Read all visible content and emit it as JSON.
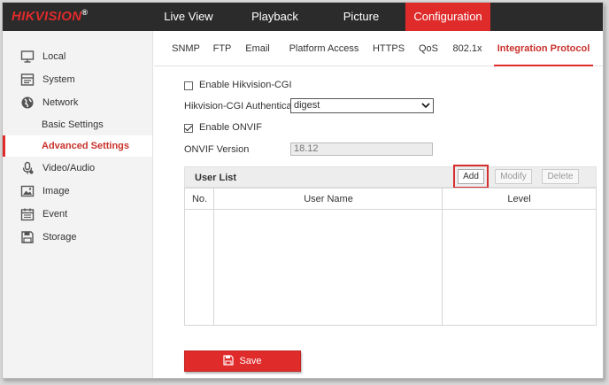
{
  "brand": {
    "logo_text": "HIKVISION",
    "logo_mark": "®"
  },
  "nav": {
    "items": [
      {
        "label": "Live View"
      },
      {
        "label": "Playback"
      },
      {
        "label": "Picture"
      },
      {
        "label": "Configuration"
      }
    ],
    "active": "Configuration"
  },
  "sidebar": {
    "items": [
      {
        "label": "Local",
        "icon": "monitor-icon"
      },
      {
        "label": "System",
        "icon": "system-icon"
      },
      {
        "label": "Network",
        "icon": "globe-icon"
      },
      {
        "label": "Basic Settings"
      },
      {
        "label": "Advanced Settings"
      },
      {
        "label": "Video/Audio",
        "icon": "microphone-icon"
      },
      {
        "label": "Image",
        "icon": "image-icon"
      },
      {
        "label": "Event",
        "icon": "calendar-icon"
      },
      {
        "label": "Storage",
        "icon": "floppy-icon"
      }
    ],
    "active": "Advanced Settings"
  },
  "tabs": {
    "items": [
      {
        "label": "SNMP"
      },
      {
        "label": "FTP"
      },
      {
        "label": "Email"
      },
      {
        "label": "Platform Access"
      },
      {
        "label": "HTTPS"
      },
      {
        "label": "QoS"
      },
      {
        "label": "802.1x"
      },
      {
        "label": "Integration Protocol"
      }
    ],
    "active": "Integration Protocol"
  },
  "form": {
    "enable_cgi_label": "Enable Hikvision-CGI",
    "enable_cgi_checked": false,
    "cgi_auth_label": "Hikvision-CGI Authenticat...",
    "cgi_auth_value": "digest",
    "enable_onvif_label": "Enable ONVIF",
    "enable_onvif_checked": true,
    "onvif_version_label": "ONVIF Version",
    "onvif_version_value": "18.12"
  },
  "user_list": {
    "title": "User List",
    "add_label": "Add",
    "modify_label": "Modify",
    "delete_label": "Delete",
    "columns": [
      "No.",
      "User Name",
      "Level"
    ],
    "rows": []
  },
  "save_label": "Save",
  "colors": {
    "accent": "#e02b2b",
    "topbar": "#2b2b2b",
    "active_text": "#c8312b"
  }
}
